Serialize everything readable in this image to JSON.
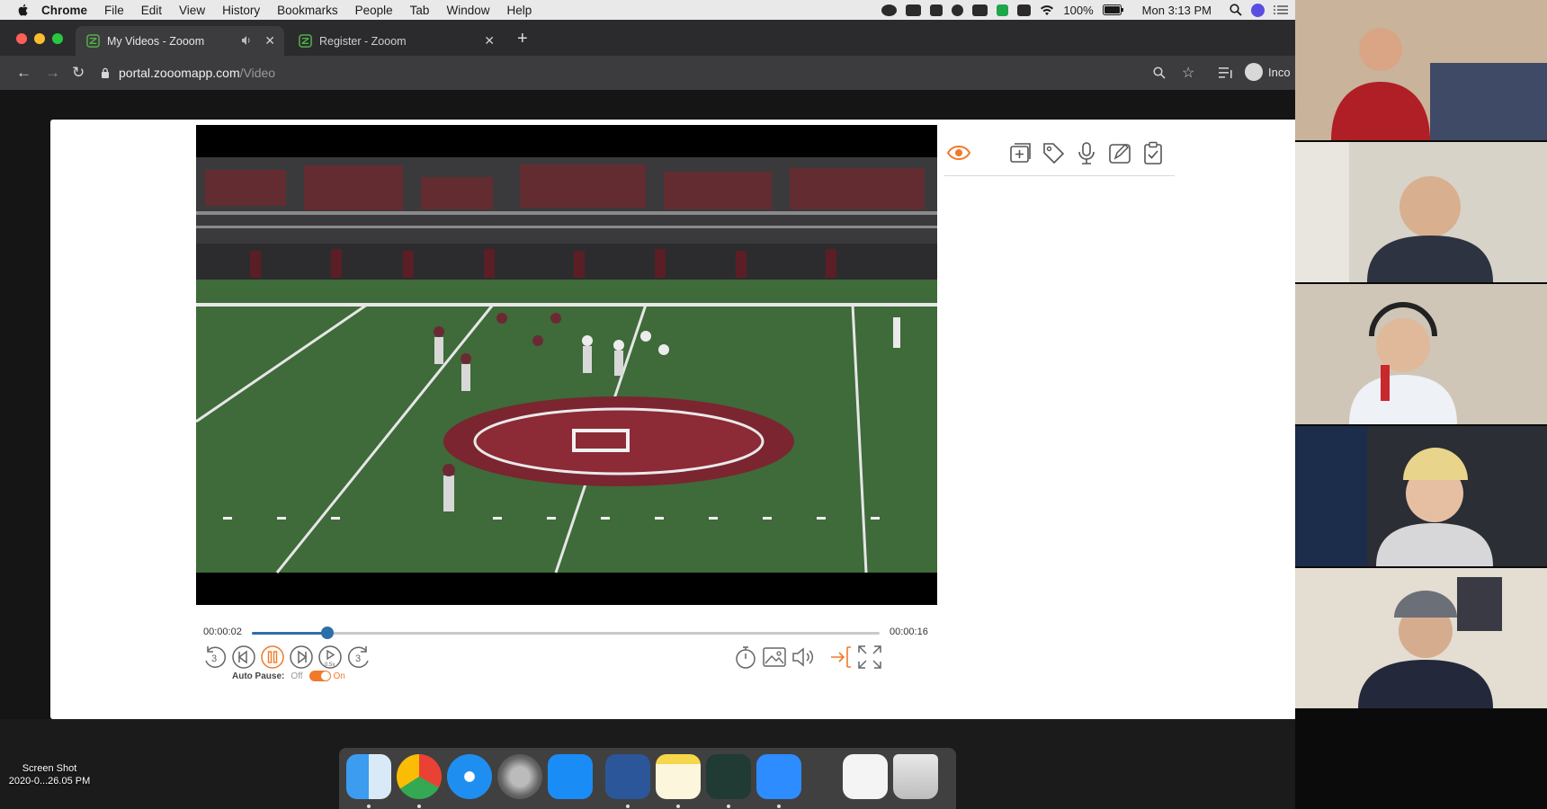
{
  "menubar": {
    "app_name": "Chrome",
    "items": [
      "File",
      "Edit",
      "View",
      "History",
      "Bookmarks",
      "People",
      "Tab",
      "Window",
      "Help"
    ],
    "battery": "100%",
    "clock": "Mon 3:13 PM"
  },
  "browser": {
    "tabs": [
      {
        "title": "My Videos - Zooom",
        "active": true
      },
      {
        "title": "Register - Zooom",
        "active": false
      }
    ],
    "url_host": "portal.zooomapp.com",
    "url_path": "/Video",
    "profile_label": "Inco"
  },
  "player": {
    "current_time": "00:00:02",
    "total_time": "00:00:16",
    "progress_fraction": 0.12,
    "auto_pause_label": "Auto Pause:",
    "toggle_off_label": "Off",
    "toggle_on_label": "On",
    "accent_color": "#f07a2a",
    "progress_color": "#2d6fa8"
  },
  "video_tools": {
    "icons": [
      "eye-icon",
      "add-clip-icon",
      "tag-icon",
      "microphone-icon",
      "edit-icon",
      "clipboard-check-icon"
    ]
  },
  "dock": {
    "apps": [
      "finder",
      "chrome",
      "safari",
      "system-preferences",
      "app-store",
      "word",
      "notes",
      "filmora",
      "zoom",
      "preview",
      "trash"
    ]
  },
  "desktop": {
    "file_name_line1": "Screen Shot",
    "file_name_line2": "2020-0...26.05 PM"
  },
  "zoom_participants": {
    "count": 5
  }
}
